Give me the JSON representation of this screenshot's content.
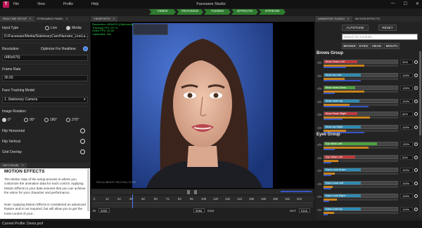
{
  "app": {
    "title": "Faceware Studio",
    "menu": [
      "File",
      "View",
      "Profile",
      "Help"
    ],
    "controls": [
      "—",
      "☐",
      "✕"
    ]
  },
  "workflow": {
    "steps": [
      "VIDEO",
      "TRACKING",
      "TUNING",
      "EFFECTS",
      "STREAM"
    ]
  },
  "left_tabs": [
    "REALTIME SETUP",
    "STREAMING PANEL"
  ],
  "realtime": {
    "input_type_label": "Input Type",
    "input_live": "Live",
    "input_media": "Media",
    "media_path": "D:/Faceware/Media/StationaryCam/Narrator_LineLa...",
    "resolution_label": "Resolution",
    "optimize_label": "Optimize For Realtime",
    "resolution_value": "(480x576)",
    "frame_rate_label": "Frame Rate",
    "frame_rate_value": "30.00",
    "tracking_model_label": "Face Tracking Model",
    "tracking_model_value": "1. Stationary Camera",
    "rotation_label": "Image Rotation",
    "rotations": [
      "0°",
      "90°",
      "180°",
      "270°"
    ],
    "flip_h": "Flip Horizontal",
    "flip_v": "Flip Vertical",
    "grid_overlay": "Grid Overlay"
  },
  "info_tab": "INFO PANEL",
  "info": {
    "title": "MOTION EFFECTS",
    "body": "The Motion step of the setup process is where you customize the animation data for each control. Applying Motion Effects to your data ensures that you can achieve the vision for your character and performance.",
    "note": "Note: Applying Motion Effects is considered an advanced feature and is not required, but will allow you to get the most control of your..."
  },
  "viewport_tab": "VIEWPORTS",
  "viewport": {
    "stats": [
      "Resolution: 480x576 (Optimized)",
      "Tracking FPS: 29.74",
      "Video FPS: 30.00",
      "Calibrated: Yes"
    ],
    "neutral_label": "RECALIBRATE NEUTRAL POSE"
  },
  "timeline": {
    "ticks": [
      "0",
      "12",
      "24",
      "36",
      "48",
      "60",
      "72",
      "84",
      "96",
      "108",
      "120",
      "132",
      "144",
      "156",
      "168",
      "180",
      "192",
      "204"
    ],
    "in_label": "IN",
    "in_value": "0000",
    "current_frame": "0056",
    "end_frame": "0119",
    "out_label": "OUT",
    "out_value": "0119"
  },
  "right_tabs": [
    "ANIMATION TUNING",
    "MOTION EFFECTS"
  ],
  "tuning": {
    "autotune": "AUTOTUNE",
    "reset": "RESET",
    "search_placeholder": "Search for Controls",
    "filters": [
      "BROWS",
      "EYES",
      "HEAD",
      "MOUTH"
    ],
    "brow_group": "Brows Group",
    "eyes_group": "Eyes Group",
    "brows": [
      {
        "name": "Brow Down Left",
        "value": "90%",
        "fill": 0.45,
        "color": "#c0393b",
        "sub": 0.55,
        "sub2": 0.3
      },
      {
        "name": "Brow Up Left",
        "value": "100%",
        "fill": 0.5,
        "color": "#2f8bb3",
        "sub": 0.28,
        "sub2": 0.5
      },
      {
        "name": "Brow Inner Down",
        "value": "126%",
        "fill": 0.42,
        "color": "#4da23e",
        "sub": 0.55,
        "sub2": 0.15
      },
      {
        "name": "Brow Inner Up",
        "value": "100%",
        "fill": 0.48,
        "color": "#2f8bb3",
        "sub": 0.35,
        "sub2": 0.6
      },
      {
        "name": "Brow Down Right",
        "value": "84%",
        "fill": 0.45,
        "color": "#c0393b",
        "sub": 0.62,
        "sub2": 0.25
      },
      {
        "name": "Brow Up Right",
        "value": "100%",
        "fill": 0.5,
        "color": "#2f8bb3",
        "sub": 0.3,
        "sub2": 0.55
      }
    ],
    "eyes": [
      {
        "name": "Eye Blink Left",
        "value": "130%",
        "fill": 0.72,
        "color": "#4da23e",
        "sub": 0.6,
        "sub2": 0.15
      },
      {
        "name": "Eye Wide Left",
        "value": "83%",
        "fill": 0.42,
        "color": "#c0393b",
        "sub": 0.2,
        "sub2": 0.1
      },
      {
        "name": "Eyes Look Down",
        "value": "100%",
        "fill": 0.5,
        "color": "#2f8bb3",
        "sub": 0.15,
        "sub2": 0.1
      },
      {
        "name": "Eyes Look Left",
        "value": "100%",
        "fill": 0.5,
        "color": "#2f8bb3",
        "sub": 0.12,
        "sub2": 0.1
      },
      {
        "name": "Eyes Look Right",
        "value": "100%",
        "fill": 0.5,
        "color": "#2f8bb3",
        "sub": 0.18,
        "sub2": 0.08
      },
      {
        "name": "Eyes Look Up",
        "value": "100%",
        "fill": 0.5,
        "color": "#2f8bb3",
        "sub": 0.14,
        "sub2": 0.06
      }
    ]
  },
  "status": {
    "profile": "Current Profile: Demo.prof"
  }
}
